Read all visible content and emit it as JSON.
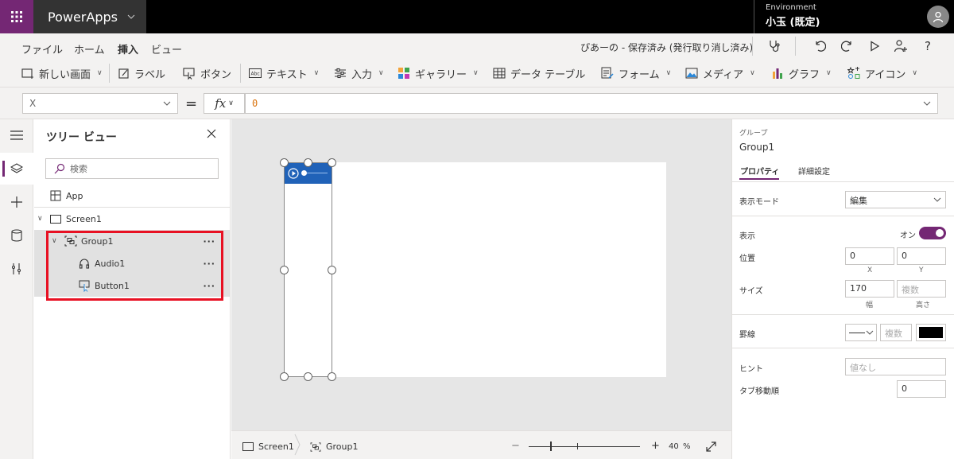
{
  "app": {
    "name": "PowerApps",
    "environment_label": "Environment",
    "environment_name": "小玉 (既定)"
  },
  "menu": {
    "tabs": [
      "ファイル",
      "ホーム",
      "挿入",
      "ビュー"
    ],
    "active_tab": "挿入",
    "status": "ぴあーの - 保存済み (発行取り消し済み)"
  },
  "ribbon": {
    "new_screen": "新しい画面",
    "label": "ラベル",
    "button": "ボタン",
    "text": "テキスト",
    "input": "入力",
    "gallery": "ギャラリー",
    "data_table": "データ テーブル",
    "form": "フォーム",
    "media": "メディア",
    "chart": "グラフ",
    "icon": "アイコン"
  },
  "formula_bar": {
    "property": "X",
    "equals": "=",
    "fx": "fx",
    "formula": "0"
  },
  "tree": {
    "title": "ツリー ビュー",
    "search_placeholder": "検索",
    "app": "App",
    "screen": "Screen1",
    "group": "Group1",
    "audio": "Audio1",
    "button": "Button1",
    "more": "···"
  },
  "canvas": {
    "breadcrumb_screen": "Screen1",
    "breadcrumb_group": "Group1",
    "zoom_minus": "−",
    "zoom_plus": "+",
    "zoom_value": "40",
    "zoom_unit": "%",
    "zoom_level_fraction": 0.2
  },
  "properties": {
    "type_label": "グループ",
    "name": "Group1",
    "tab_properties": "プロパティ",
    "tab_advanced": "詳細設定",
    "display_mode_label": "表示モード",
    "display_mode_value": "編集",
    "visible_label": "表示",
    "visible_value": "オン",
    "position_label": "位置",
    "x_value": "0",
    "y_value": "0",
    "x_sub": "X",
    "y_sub": "Y",
    "size_label": "サイズ",
    "width_value": "170",
    "height_placeholder": "複数",
    "width_sub": "幅",
    "height_sub": "高さ",
    "border_label": "罫線",
    "border_width_placeholder": "複数",
    "border_color": "#000000",
    "hint_label": "ヒント",
    "hint_placeholder": "値なし",
    "tab_index_label": "タブ移動順",
    "tab_index_value": "0"
  },
  "colors": {
    "accent": "#742774",
    "selection": "#e81123",
    "audio_bar": "#2062b8"
  }
}
